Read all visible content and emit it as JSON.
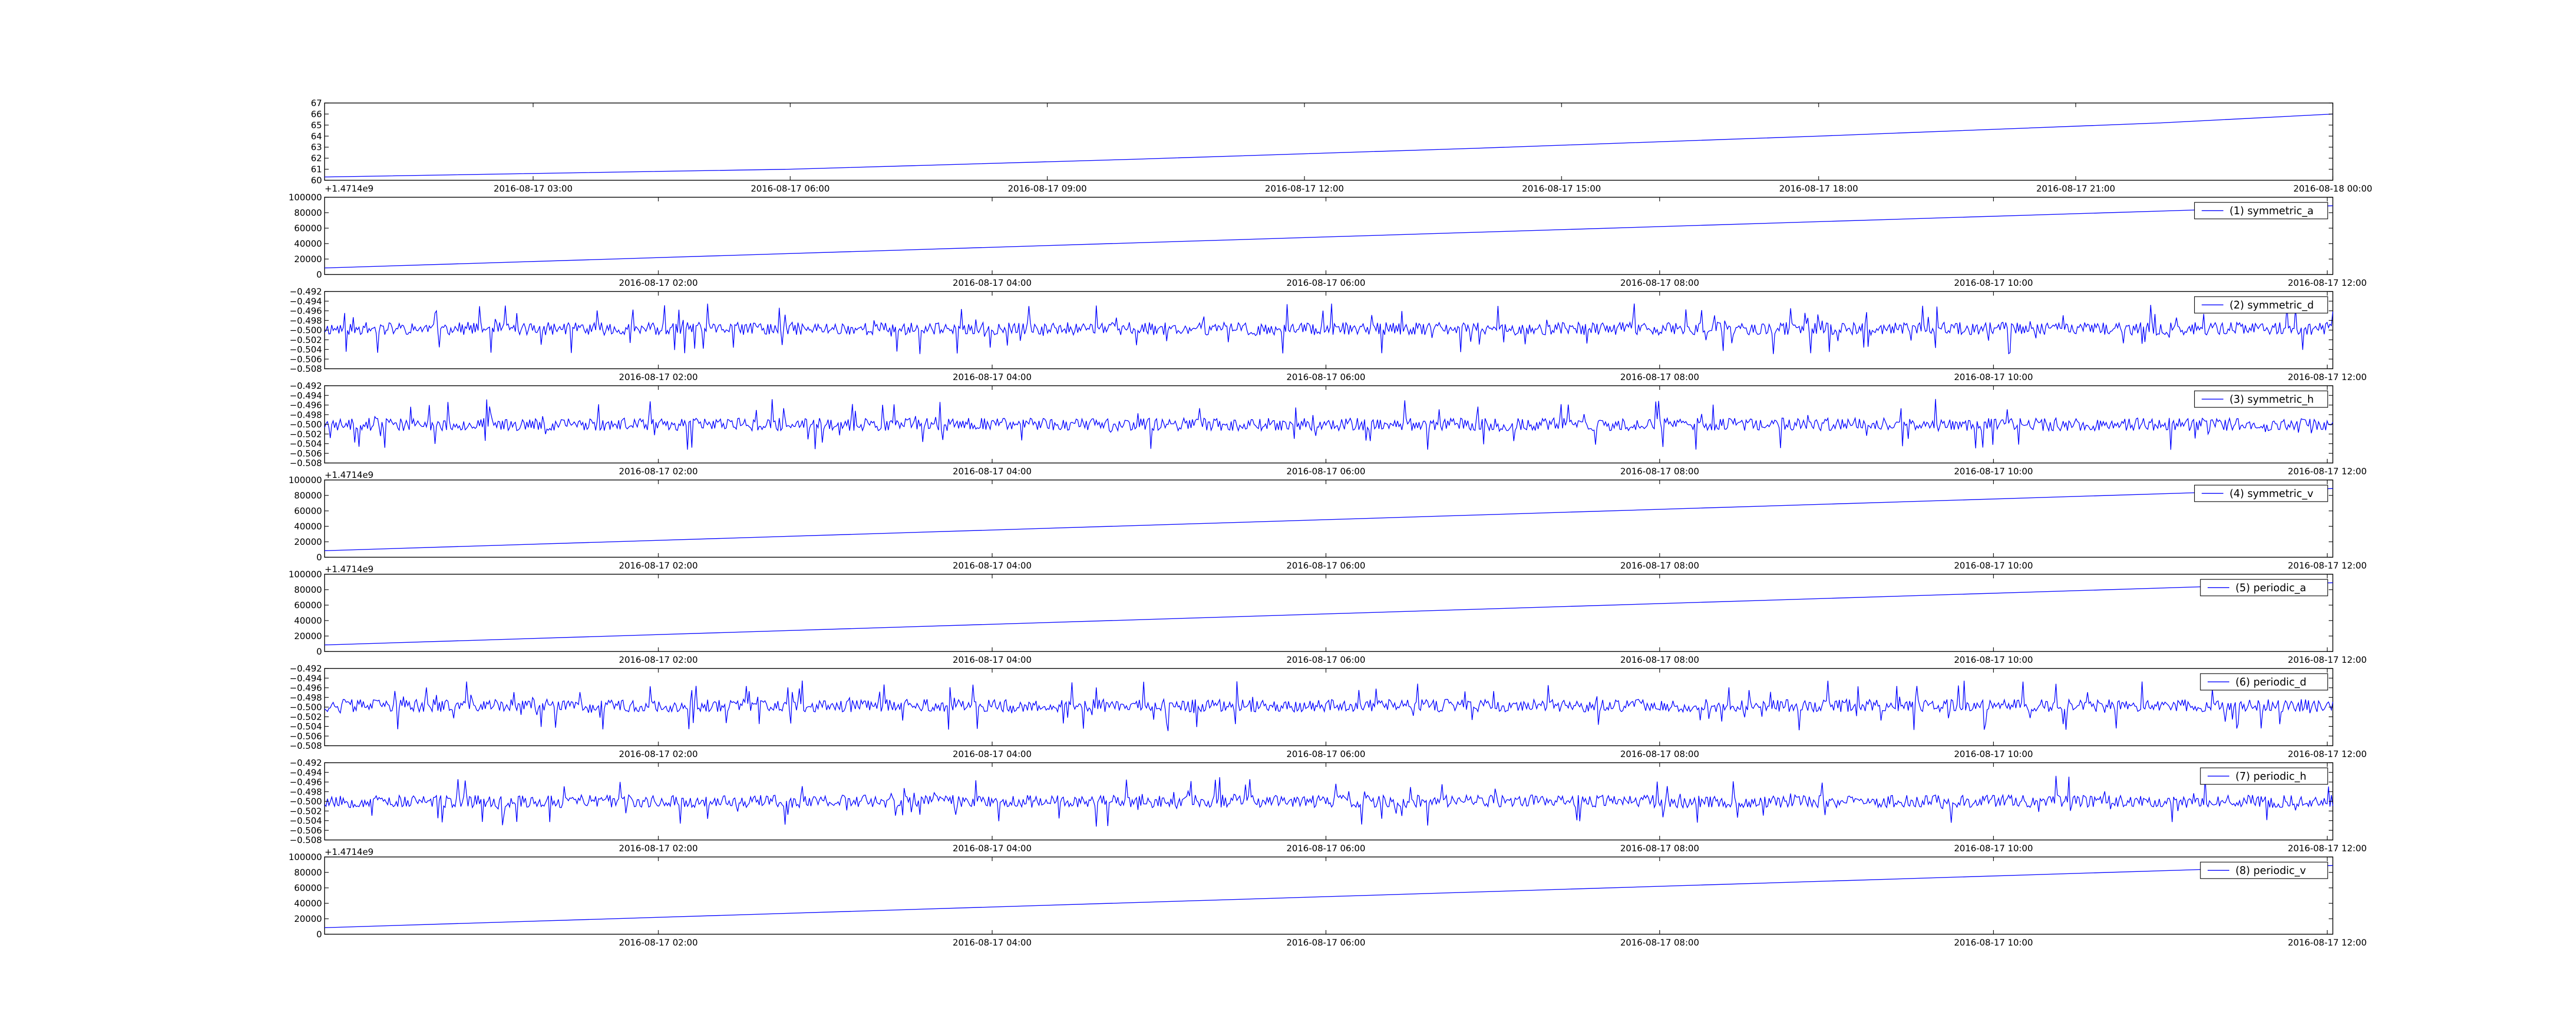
{
  "figure": {
    "background": "#ffffff",
    "line_color": "#0000ff",
    "axes_color": "#000000"
  },
  "chart_data": [
    {
      "type": "line",
      "title": "",
      "xlabel": "",
      "ylabel": "",
      "x_ticks": [
        "2016-08-17 03:00",
        "2016-08-17 06:00",
        "2016-08-17 09:00",
        "2016-08-17 12:00",
        "2016-08-17 15:00",
        "2016-08-17 18:00",
        "2016-08-17 21:00",
        "2016-08-18 00:00"
      ],
      "x_start": "2016-08-17 00:34",
      "x_end": "2016-08-18 00:00",
      "ylim": [
        60,
        67
      ],
      "y_ticks": [
        "60",
        "61",
        "62",
        "63",
        "64",
        "65",
        "66",
        "67"
      ],
      "y_offset_label": "+1.4714e9",
      "grid": false,
      "legend": null,
      "series": [
        {
          "values": [
            {
              "x": "2016-08-17 00:34",
              "y": 60.3
            },
            {
              "x": "2016-08-17 06:00",
              "y": 61.0
            },
            {
              "x": "2016-08-17 10:00",
              "y": 61.9
            },
            {
              "x": "2016-08-17 14:00",
              "y": 62.9
            },
            {
              "x": "2016-08-17 18:00",
              "y": 64.0
            },
            {
              "x": "2016-08-17 22:00",
              "y": 65.2
            },
            {
              "x": "2016-08-18 00:00",
              "y": 66.0
            }
          ]
        }
      ]
    },
    {
      "type": "line",
      "x_ticks": [
        "2016-08-17 02:00",
        "2016-08-17 04:00",
        "2016-08-17 06:00",
        "2016-08-17 08:00",
        "2016-08-17 10:00",
        "2016-08-17 12:00"
      ],
      "x_start": "2016-08-17 00:00",
      "x_end": "2016-08-17 12:02",
      "ylim": [
        0,
        100000
      ],
      "y_ticks": [
        "0",
        "20000",
        "40000",
        "60000",
        "80000",
        "100000"
      ],
      "grid": false,
      "legend": "top-right",
      "series": [
        {
          "name": "(1) symmetric_a",
          "kind": "ramp",
          "y_start": 8500,
          "y_end": 89000
        }
      ]
    },
    {
      "type": "line",
      "x_ticks": [
        "2016-08-17 02:00",
        "2016-08-17 04:00",
        "2016-08-17 06:00",
        "2016-08-17 08:00",
        "2016-08-17 10:00",
        "2016-08-17 12:00"
      ],
      "x_start": "2016-08-17 00:00",
      "x_end": "2016-08-17 12:02",
      "ylim": [
        -0.508,
        -0.492
      ],
      "y_ticks": [
        "−0.508",
        "−0.506",
        "−0.504",
        "−0.502",
        "−0.500",
        "−0.498",
        "−0.496",
        "−0.494",
        "−0.492"
      ],
      "grid": false,
      "legend": "top-right",
      "series": [
        {
          "name": "(2) symmetric_d",
          "kind": "noise",
          "center": -0.4997,
          "spread": 0.0048,
          "seed": 11
        }
      ]
    },
    {
      "type": "line",
      "x_ticks": [
        "2016-08-17 02:00",
        "2016-08-17 04:00",
        "2016-08-17 06:00",
        "2016-08-17 08:00",
        "2016-08-17 10:00",
        "2016-08-17 12:00"
      ],
      "x_start": "2016-08-17 00:00",
      "x_end": "2016-08-17 12:02",
      "ylim": [
        -0.508,
        -0.492
      ],
      "y_ticks": [
        "−0.508",
        "−0.506",
        "−0.504",
        "−0.502",
        "−0.500",
        "−0.498",
        "−0.496",
        "−0.494",
        "−0.492"
      ],
      "grid": false,
      "legend": "top-right",
      "series": [
        {
          "name": "(3) symmetric_h",
          "kind": "noise",
          "center": -0.5,
          "spread": 0.0048,
          "seed": 23
        }
      ]
    },
    {
      "type": "line",
      "x_ticks": [
        "2016-08-17 02:00",
        "2016-08-17 04:00",
        "2016-08-17 06:00",
        "2016-08-17 08:00",
        "2016-08-17 10:00",
        "2016-08-17 12:00"
      ],
      "x_start": "2016-08-17 00:00",
      "x_end": "2016-08-17 12:02",
      "ylim": [
        0,
        100000
      ],
      "y_ticks": [
        "0",
        "20000",
        "40000",
        "60000",
        "80000",
        "100000"
      ],
      "y_offset_label": "+1.4714e9",
      "grid": false,
      "legend": "top-right",
      "series": [
        {
          "name": "(4) symmetric_v",
          "kind": "ramp",
          "y_start": 8500,
          "y_end": 89000
        }
      ]
    },
    {
      "type": "line",
      "x_ticks": [
        "2016-08-17 02:00",
        "2016-08-17 04:00",
        "2016-08-17 06:00",
        "2016-08-17 08:00",
        "2016-08-17 10:00",
        "2016-08-17 12:00"
      ],
      "x_start": "2016-08-17 00:00",
      "x_end": "2016-08-17 12:02",
      "ylim": [
        0,
        100000
      ],
      "y_ticks": [
        "0",
        "20000",
        "40000",
        "60000",
        "80000",
        "100000"
      ],
      "y_offset_label": "+1.4714e9",
      "grid": false,
      "legend": "top-right",
      "series": [
        {
          "name": "(5) periodic_a",
          "kind": "ramp",
          "y_start": 8500,
          "y_end": 89000
        }
      ]
    },
    {
      "type": "line",
      "x_ticks": [
        "2016-08-17 02:00",
        "2016-08-17 04:00",
        "2016-08-17 06:00",
        "2016-08-17 08:00",
        "2016-08-17 10:00",
        "2016-08-17 12:00"
      ],
      "x_start": "2016-08-17 00:00",
      "x_end": "2016-08-17 12:02",
      "ylim": [
        -0.508,
        -0.492
      ],
      "y_ticks": [
        "−0.508",
        "−0.506",
        "−0.504",
        "−0.502",
        "−0.500",
        "−0.498",
        "−0.496",
        "−0.494",
        "−0.492"
      ],
      "grid": false,
      "legend": "top-right",
      "series": [
        {
          "name": "(6) periodic_d",
          "kind": "noise",
          "center": -0.4997,
          "spread": 0.0048,
          "seed": 37
        }
      ]
    },
    {
      "type": "line",
      "x_ticks": [
        "2016-08-17 02:00",
        "2016-08-17 04:00",
        "2016-08-17 06:00",
        "2016-08-17 08:00",
        "2016-08-17 10:00",
        "2016-08-17 12:00"
      ],
      "x_start": "2016-08-17 00:00",
      "x_end": "2016-08-17 12:02",
      "ylim": [
        -0.508,
        -0.492
      ],
      "y_ticks": [
        "−0.508",
        "−0.506",
        "−0.504",
        "−0.502",
        "−0.500",
        "−0.498",
        "−0.496",
        "−0.494",
        "−0.492"
      ],
      "grid": false,
      "legend": "top-right",
      "series": [
        {
          "name": "(7) periodic_h",
          "kind": "noise",
          "center": -0.5,
          "spread": 0.0048,
          "seed": 53
        }
      ]
    },
    {
      "type": "line",
      "x_ticks": [
        "2016-08-17 02:00",
        "2016-08-17 04:00",
        "2016-08-17 06:00",
        "2016-08-17 08:00",
        "2016-08-17 10:00",
        "2016-08-17 12:00"
      ],
      "x_start": "2016-08-17 00:00",
      "x_end": "2016-08-17 12:02",
      "ylim": [
        0,
        100000
      ],
      "y_ticks": [
        "0",
        "20000",
        "40000",
        "60000",
        "80000",
        "100000"
      ],
      "y_offset_label": "+1.4714e9",
      "grid": false,
      "legend": "top-right",
      "series": [
        {
          "name": "(8) periodic_v",
          "kind": "ramp",
          "y_start": 8500,
          "y_end": 89000
        }
      ]
    }
  ]
}
